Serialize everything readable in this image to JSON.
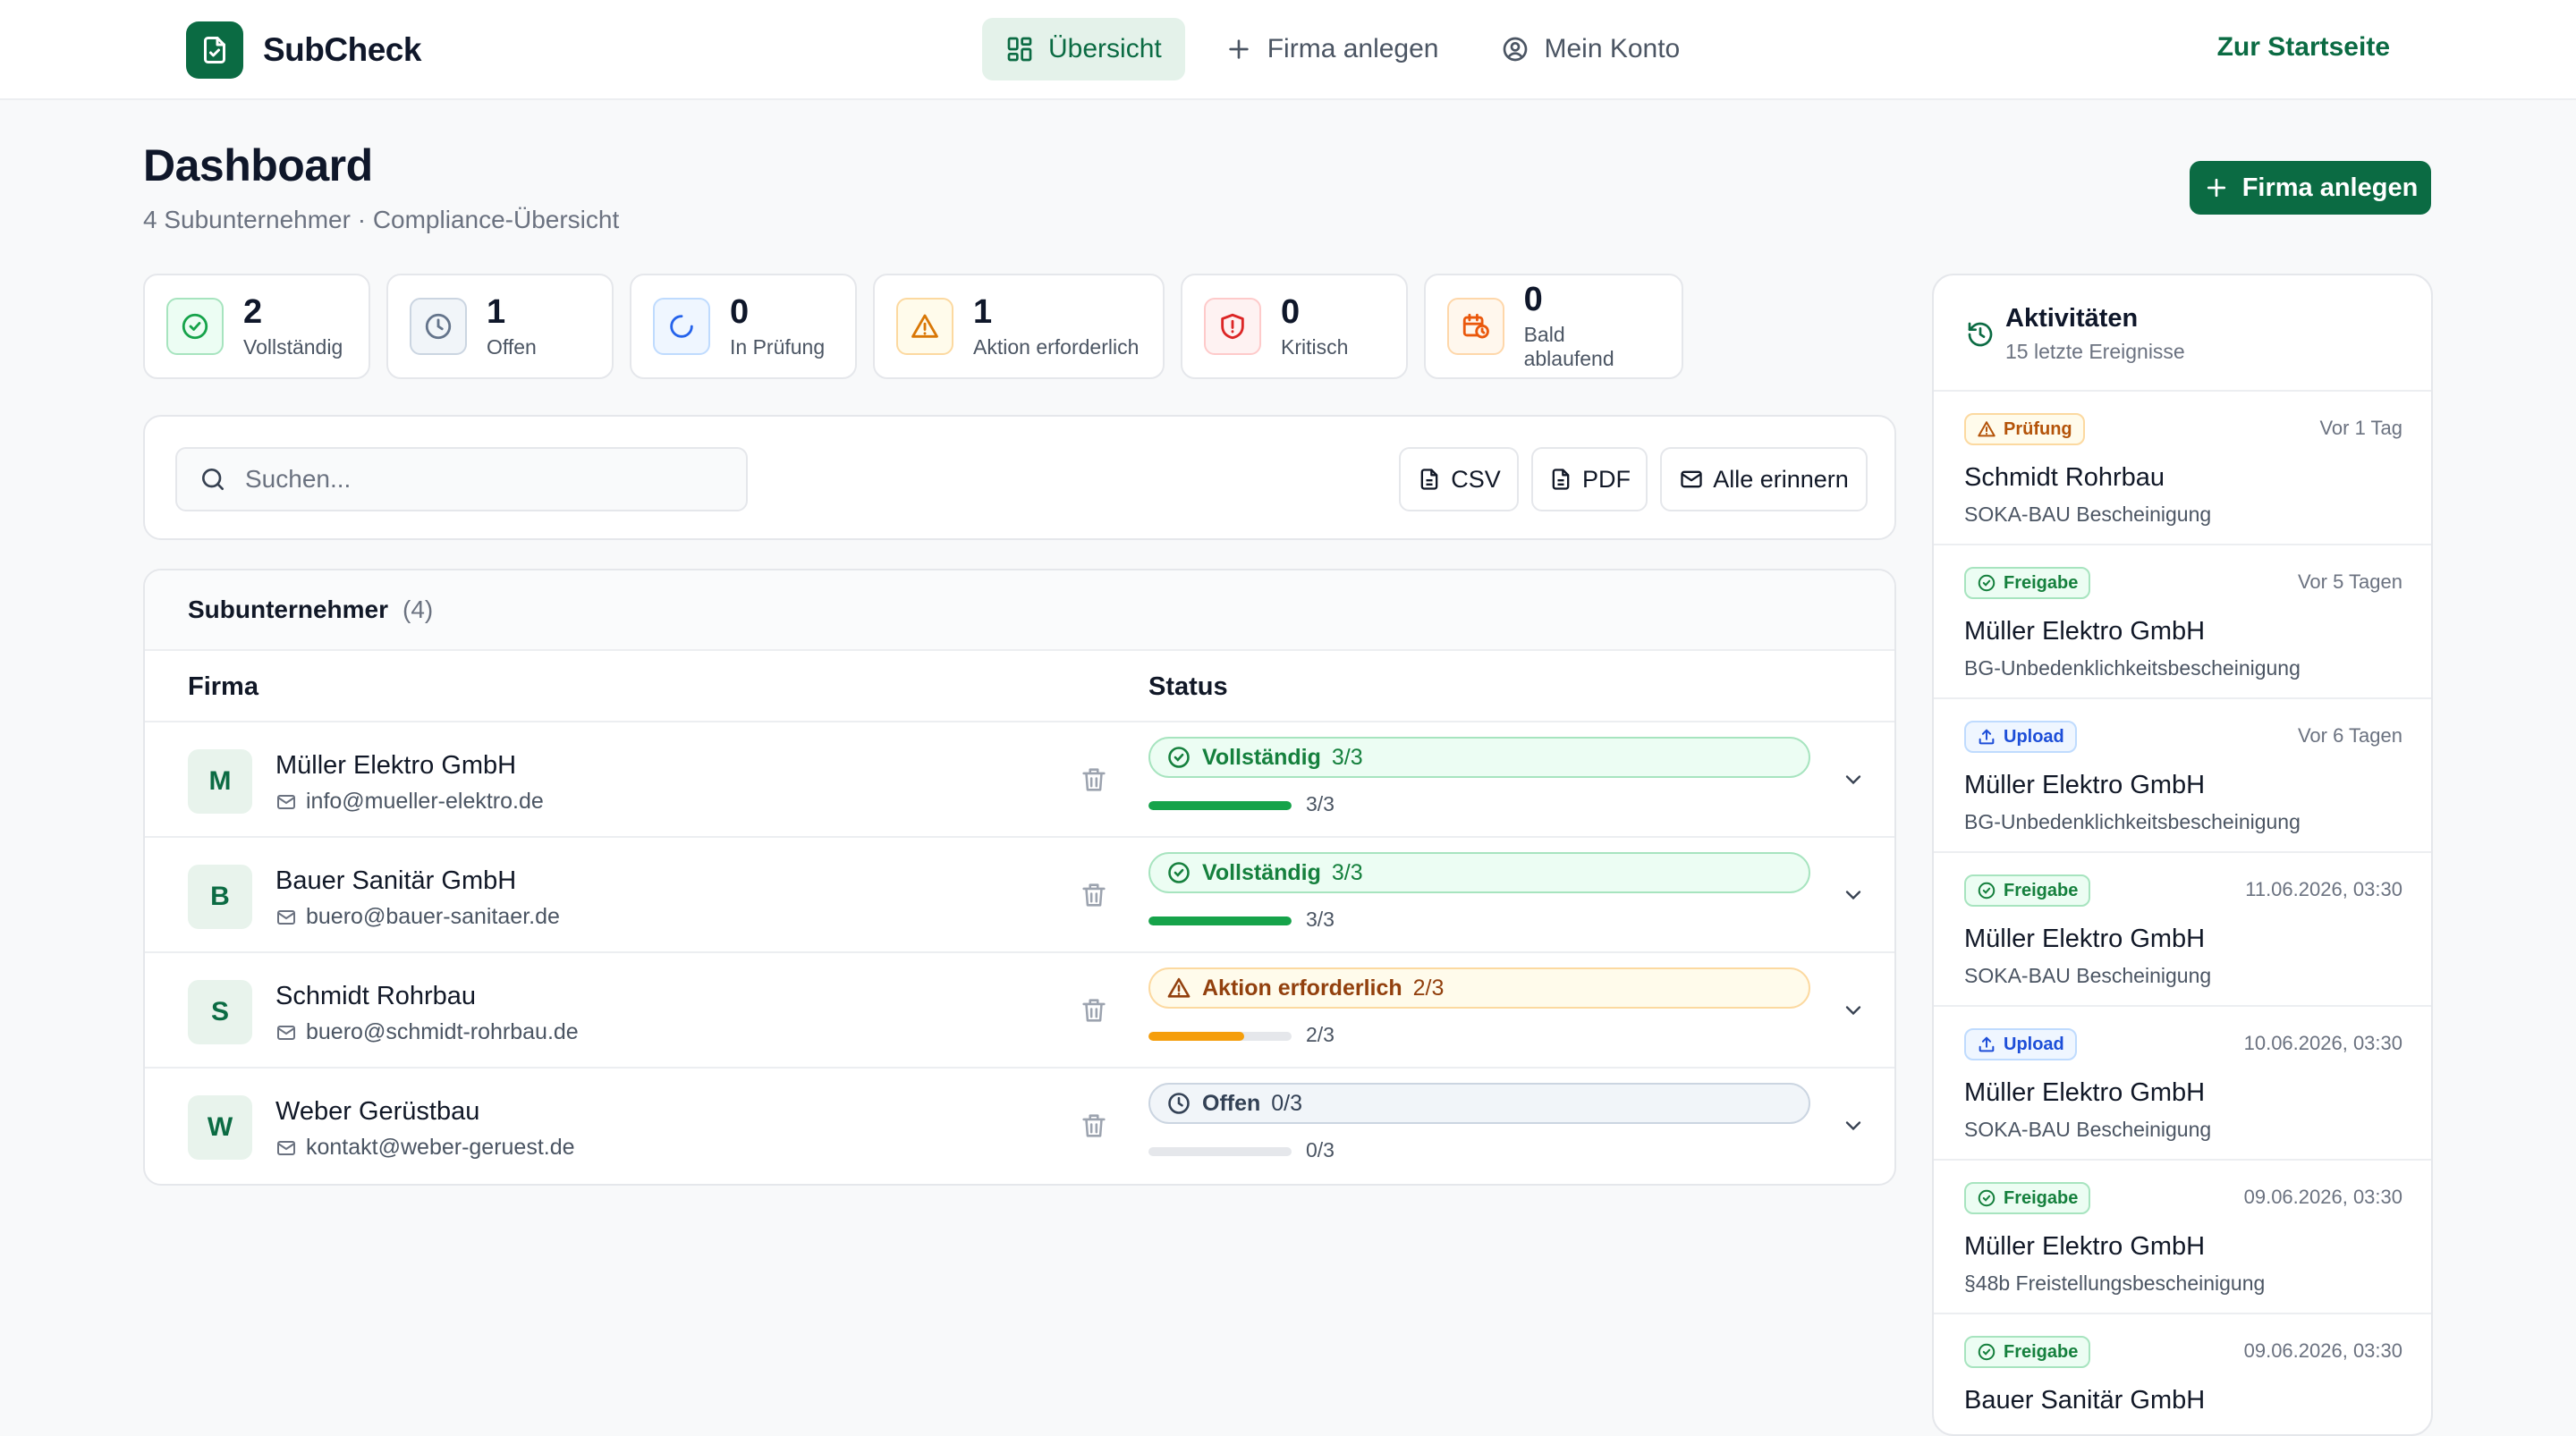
{
  "app": {
    "name": "SubCheck",
    "nav": [
      {
        "label": "Übersicht",
        "icon": "grid-icon",
        "active": true
      },
      {
        "label": "Firma anlegen",
        "icon": "plus-icon",
        "active": false
      },
      {
        "label": "Mein Konto",
        "icon": "user-circle-icon",
        "active": false
      }
    ],
    "home_link": "Zur Startseite"
  },
  "header": {
    "title": "Dashboard",
    "subtitle": "4 Subunternehmer · Compliance-Übersicht",
    "add_button": "Firma anlegen"
  },
  "stats": [
    {
      "value": "2",
      "label": "Vollständig",
      "icon": "check-circle-icon",
      "color": "#16a34a"
    },
    {
      "value": "1",
      "label": "Offen",
      "icon": "clock-icon",
      "color": "#64748b"
    },
    {
      "value": "0",
      "label": "In Prüfung",
      "icon": "spinner-icon",
      "color": "#2563eb"
    },
    {
      "value": "1",
      "label": "Aktion erforderlich",
      "icon": "warning-icon",
      "color": "#d97706"
    },
    {
      "value": "0",
      "label": "Kritisch",
      "icon": "shield-alert-icon",
      "color": "#dc2626"
    },
    {
      "value": "0",
      "label": "Bald ablaufend",
      "icon": "calendar-clock-icon",
      "color": "#ea580c"
    }
  ],
  "toolbar": {
    "search_placeholder": "Suchen...",
    "csv": "CSV",
    "pdf": "PDF",
    "remind_all": "Alle erinnern"
  },
  "table": {
    "title": "Subunternehmer",
    "count": "(4)",
    "col_company": "Firma",
    "col_status": "Status",
    "rows": [
      {
        "initial": "M",
        "name": "Müller Elektro GmbH",
        "email": "info@mueller-elektro.de",
        "status": "Vollständig",
        "ratio": "3/3",
        "progress": 1.0,
        "kind": "complete"
      },
      {
        "initial": "B",
        "name": "Bauer Sanitär GmbH",
        "email": "buero@bauer-sanitaer.de",
        "status": "Vollständig",
        "ratio": "3/3",
        "progress": 1.0,
        "kind": "complete"
      },
      {
        "initial": "S",
        "name": "Schmidt Rohrbau",
        "email": "buero@schmidt-rohrbau.de",
        "status": "Aktion erforderlich",
        "ratio": "2/3",
        "progress": 0.67,
        "kind": "action"
      },
      {
        "initial": "W",
        "name": "Weber Gerüstbau",
        "email": "kontakt@weber-geruest.de",
        "status": "Offen",
        "ratio": "0/3",
        "progress": 0.0,
        "kind": "open"
      }
    ]
  },
  "activity": {
    "title": "Aktivitäten",
    "subtitle": "15 letzte Ereignisse",
    "items": [
      {
        "badge": "Prüfung",
        "kind": "review",
        "time": "Vor 1 Tag",
        "company": "Schmidt Rohrbau",
        "document": "SOKA-BAU Bescheinigung"
      },
      {
        "badge": "Freigabe",
        "kind": "approve",
        "time": "Vor 5 Tagen",
        "company": "Müller Elektro GmbH",
        "document": "BG-Unbedenklichkeitsbescheinigung"
      },
      {
        "badge": "Upload",
        "kind": "upload",
        "time": "Vor 6 Tagen",
        "company": "Müller Elektro GmbH",
        "document": "BG-Unbedenklichkeitsbescheinigung"
      },
      {
        "badge": "Freigabe",
        "kind": "approve",
        "time": "11.06.2026, 03:30",
        "company": "Müller Elektro GmbH",
        "document": "SOKA-BAU Bescheinigung"
      },
      {
        "badge": "Upload",
        "kind": "upload",
        "time": "10.06.2026, 03:30",
        "company": "Müller Elektro GmbH",
        "document": "SOKA-BAU Bescheinigung"
      },
      {
        "badge": "Freigabe",
        "kind": "approve",
        "time": "09.06.2026, 03:30",
        "company": "Müller Elektro GmbH",
        "document": "§48b Freistellungsbescheinigung"
      },
      {
        "badge": "Freigabe",
        "kind": "approve",
        "time": "09.06.2026, 03:30",
        "company": "Bauer Sanitär GmbH",
        "document": ""
      }
    ]
  },
  "colors": {
    "brand": "#0b6b43",
    "complete": "#16a34a",
    "action": "#f59e0b",
    "open": "#64748b"
  }
}
